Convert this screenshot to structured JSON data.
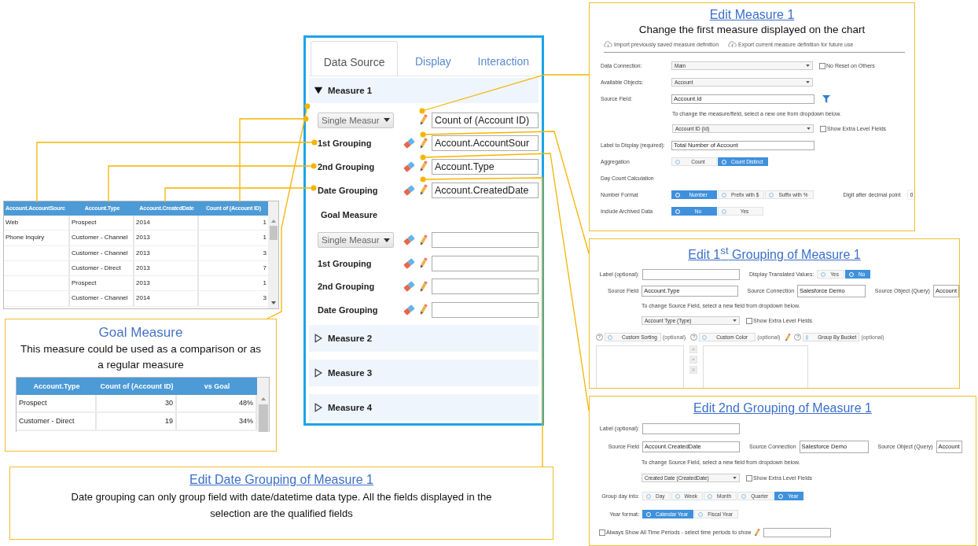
{
  "data_table": {
    "columns": [
      "Account.AccountSourc",
      "Account.Type",
      "Account.CreatedDate",
      "Count of (Account ID)"
    ],
    "rows": [
      [
        "Web",
        "Prospect",
        "2014",
        "1"
      ],
      [
        "Phone Inquiry",
        "Customer - Channel",
        "2013",
        "1"
      ],
      [
        null,
        "Customer - Channel",
        "2013",
        "3"
      ],
      [
        null,
        "Customer - Direct",
        "2013",
        "7"
      ],
      [
        null,
        "Prospect",
        "2013",
        "1"
      ],
      [
        null,
        "Customer - Channel",
        "2014",
        "3"
      ]
    ]
  },
  "goal_callout": {
    "title": "Goal Measure",
    "description": "This measure could be used as a comparison or as a regular measure",
    "table": {
      "columns": [
        "Account.Type",
        "Count of (Account ID)",
        "vs Goal"
      ],
      "rows": [
        [
          "Prospect",
          "30",
          "48%"
        ],
        [
          "Customer - Direct",
          "19",
          "34%"
        ]
      ]
    }
  },
  "config_panel": {
    "tabs": [
      {
        "label": "Data Source",
        "selected": true
      },
      {
        "label": "Display",
        "selected": false
      },
      {
        "label": "Interaction",
        "selected": false
      }
    ],
    "measures": [
      {
        "title": "Measure 1",
        "expanded": true,
        "rows": [
          {
            "kind": "select",
            "label": "Single Measur",
            "value": "Count of (Account ID)",
            "clearable": false
          },
          {
            "kind": "grouping",
            "label": "1st Grouping",
            "value": "Account.AccountSour",
            "clearable": true
          },
          {
            "kind": "grouping",
            "label": "2nd Grouping",
            "value": "Account.Type",
            "clearable": true
          },
          {
            "kind": "grouping",
            "label": "Date Grouping",
            "value": "Account.CreatedDate",
            "clearable": true
          }
        ],
        "goal": {
          "title": "Goal Measure",
          "rows": [
            {
              "kind": "select",
              "label": "Single Measur",
              "clearable": true
            },
            {
              "kind": "grouping",
              "label": "1st Grouping",
              "clearable": true
            },
            {
              "kind": "grouping",
              "label": "2nd Grouping",
              "clearable": true
            },
            {
              "kind": "grouping",
              "label": "Date Grouping",
              "clearable": true
            }
          ]
        }
      },
      {
        "title": "Measure 2",
        "expanded": false
      },
      {
        "title": "Measure 3",
        "expanded": false
      },
      {
        "title": "Measure 4",
        "expanded": false
      }
    ]
  },
  "edit_panels": [
    {
      "title": "Edit Measure 1",
      "subtitle": "Change the first measure displayed on the chart",
      "actions": [
        "Import previously saved measure definition",
        "Export current measure definition for future use"
      ],
      "rows": [
        {
          "items": [
            {
              "kind": "label",
              "text": "Data Connection:"
            },
            {
              "kind": "select",
              "value": "Main"
            },
            {
              "kind": "checkbox",
              "label": "No Reset on Others",
              "checked": false
            }
          ]
        },
        {
          "items": [
            {
              "kind": "label",
              "text": "Available Objects:"
            },
            {
              "kind": "select",
              "value": "Account"
            }
          ]
        },
        {
          "items": [
            {
              "kind": "label",
              "text": "Source Field:"
            },
            {
              "kind": "input",
              "value": "Account.Id"
            },
            {
              "kind": "filter"
            }
          ]
        },
        {
          "items": [
            {
              "kind": "hint",
              "text": "To change the measure/field, select a new one from dropdown below."
            }
          ]
        },
        {
          "items": [
            {
              "kind": "select",
              "value": "Account ID (Id)"
            },
            {
              "kind": "checkbox",
              "label": "Show Extra Level Fields",
              "checked": false
            }
          ]
        },
        {
          "items": [
            {
              "kind": "label",
              "text": "Label to Display (required):"
            },
            {
              "kind": "input",
              "value": "Total Number of Account"
            }
          ]
        },
        {
          "items": [
            {
              "kind": "label",
              "text": "Aggregation"
            },
            {
              "kind": "segmented",
              "options": [
                {
                  "label": "Count",
                  "selected": false
                },
                {
                  "label": "Count Distinct",
                  "selected": true
                }
              ]
            }
          ]
        },
        {
          "items": [
            {
              "kind": "label",
              "text": "Day Count Calculation"
            }
          ]
        },
        {
          "items": [
            {
              "kind": "label",
              "text": "Number Format"
            },
            {
              "kind": "segmented",
              "options": [
                {
                  "label": "Number",
                  "selected": true
                },
                {
                  "label": "Prefix with $",
                  "selected": false
                },
                {
                  "label": "Suffix with %",
                  "selected": false
                }
              ]
            },
            {
              "kind": "label",
              "text": "Digit after decimal point"
            },
            {
              "kind": "spinner",
              "value": "0"
            }
          ]
        },
        {
          "items": [
            {
              "kind": "label",
              "text": "Include Archived Data"
            },
            {
              "kind": "segmented",
              "options": [
                {
                  "label": "No",
                  "selected": true
                },
                {
                  "label": "Yes",
                  "selected": false
                }
              ]
            }
          ]
        }
      ]
    },
    {
      "title": "Edit 1$^{st}$ Grouping of Measure 1",
      "rows": [
        {
          "items": [
            {
              "kind": "label",
              "text": "Label (optional):"
            },
            {
              "kind": "input"
            },
            {
              "kind": "label",
              "text": "Display Translated Values:"
            },
            {
              "kind": "segmented",
              "options": [
                {
                  "label": "Yes",
                  "selected": false
                },
                {
                  "label": "No",
                  "selected": true
                }
              ]
            }
          ]
        },
        {
          "items": [
            {
              "kind": "label",
              "text": "Source Field"
            },
            {
              "kind": "input",
              "value": "Account.Type"
            },
            {
              "kind": "label",
              "text": "Source Connection"
            },
            {
              "kind": "input",
              "value": "Salesforce Demo"
            },
            {
              "kind": "label",
              "text": "Source Object (Query)"
            },
            {
              "kind": "input",
              "value": "Account"
            }
          ]
        },
        {
          "items": [
            {
              "kind": "hint",
              "text": "To change Source Field, select a new field from dropdown below."
            }
          ]
        },
        {
          "items": [
            {
              "kind": "select",
              "value": "Account Type (Type)"
            },
            {
              "kind": "checkbox",
              "label": "Show Extra Level Fields",
              "checked": false
            }
          ]
        },
        {
          "items": [
            {
              "kind": "toggle",
              "help": "?",
              "label": "Custom Sorting",
              "note": "(optional)"
            },
            {
              "kind": "toggle",
              "help": "?",
              "label": "Custom Color",
              "note": "(optional)"
            },
            {
              "kind": "pencil"
            },
            {
              "kind": "toggle",
              "help": "?",
              "label": "Group By Bucket",
              "note": "(optional)"
            }
          ]
        },
        {
          "items": [
            {
              "kind": "listbox"
            },
            {
              "kind": "reorder"
            },
            {
              "kind": "listbox"
            }
          ]
        }
      ]
    },
    {
      "title": "Edit 2nd Grouping of Measure 1",
      "rows": [
        {
          "items": [
            {
              "kind": "label",
              "text": "Label (optional):"
            },
            {
              "kind": "input"
            }
          ]
        },
        {
          "items": [
            {
              "kind": "label",
              "text": "Source Field"
            },
            {
              "kind": "input",
              "value": "Account.CreatedDate"
            },
            {
              "kind": "label",
              "text": "Source Connection"
            },
            {
              "kind": "input",
              "value": "Salesforce Demo"
            },
            {
              "kind": "label",
              "text": "Source Object (Query)"
            },
            {
              "kind": "input",
              "value": "Account"
            }
          ]
        },
        {
          "items": [
            {
              "kind": "hint",
              "text": "To change Source Field, select a new field from dropdown below."
            }
          ]
        },
        {
          "items": [
            {
              "kind": "select",
              "value": "Created Date (CreatedDate)"
            },
            {
              "kind": "checkbox",
              "label": "Show Extra Level Fields",
              "checked": false
            }
          ]
        },
        {
          "items": [
            {
              "kind": "label",
              "text": "Group day into:"
            },
            {
              "kind": "segmented",
              "options": [
                {
                  "label": "Day",
                  "selected": false
                },
                {
                  "label": "Week",
                  "selected": false
                },
                {
                  "label": "Month",
                  "selected": false
                },
                {
                  "label": "Quarter",
                  "selected": false
                },
                {
                  "label": "Year",
                  "selected": true
                }
              ]
            }
          ]
        },
        {
          "items": [
            {
              "kind": "label",
              "text": "Year format:"
            },
            {
              "kind": "segmented",
              "options": [
                {
                  "label": "Calendar Year",
                  "selected": true
                },
                {
                  "label": "Fiscal Year",
                  "selected": false
                }
              ]
            }
          ]
        },
        {
          "items": [
            {
              "kind": "checkbox",
              "label": "Always Show All Time Periods - select time periods to show",
              "checked": false
            },
            {
              "kind": "pencil"
            },
            {
              "kind": "input"
            }
          ]
        }
      ]
    }
  ],
  "date_callout": {
    "title": "Edit Date Grouping of Measure 1",
    "description": "Date grouping can only group field with date/datetime data type.  All the fields displayed in the selection are the qualified fields"
  }
}
